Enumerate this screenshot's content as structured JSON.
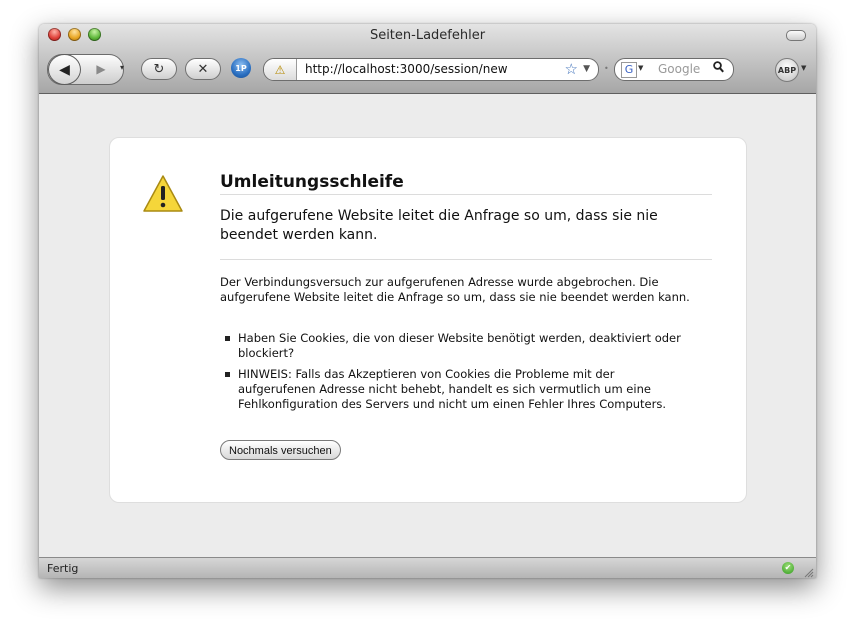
{
  "window": {
    "title": "Seiten-Ladefehler"
  },
  "toolbar": {
    "back_glyph": "◀",
    "forward_glyph": "▶",
    "dropdown_glyph": "▾",
    "reload_glyph": "↻",
    "stop_glyph": "✕",
    "onepassword_label": "1P",
    "url": "http://localhost:3000/session/new",
    "url_warning_glyph": "⚠",
    "bookmark_glyph": "☆",
    "search_engine_label": "G",
    "search_placeholder": "Google",
    "search_glyph": "🔍",
    "abp_label": "ABP"
  },
  "error_page": {
    "heading": "Umleitungsschleife",
    "subheading": "Die aufgerufene Website leitet die Anfrage so um, dass sie nie beendet werden kann.",
    "body": "Der Verbindungsversuch zur aufgerufenen Adresse wurde abgebrochen. Die aufgerufene Website leitet die Anfrage so um, dass sie nie beendet werden kann.",
    "bullets": [
      "Haben Sie Cookies, die von dieser Website benötigt werden, deaktiviert oder blockiert?",
      "HINWEIS: Falls das Akzeptieren von Cookies die Probleme mit der aufgerufenen Adresse nicht behebt, handelt es sich vermutlich um eine Fehlkonfiguration des Servers und nicht um einen Fehler Ihres Computers."
    ],
    "retry_label": "Nochmals versuchen"
  },
  "statusbar": {
    "text": "Fertig",
    "ok_glyph": "✔"
  },
  "colors": {
    "warning_yellow": "#f5d63a",
    "status_green": "#2f9a1d",
    "star_blue": "#3c6fb9"
  }
}
